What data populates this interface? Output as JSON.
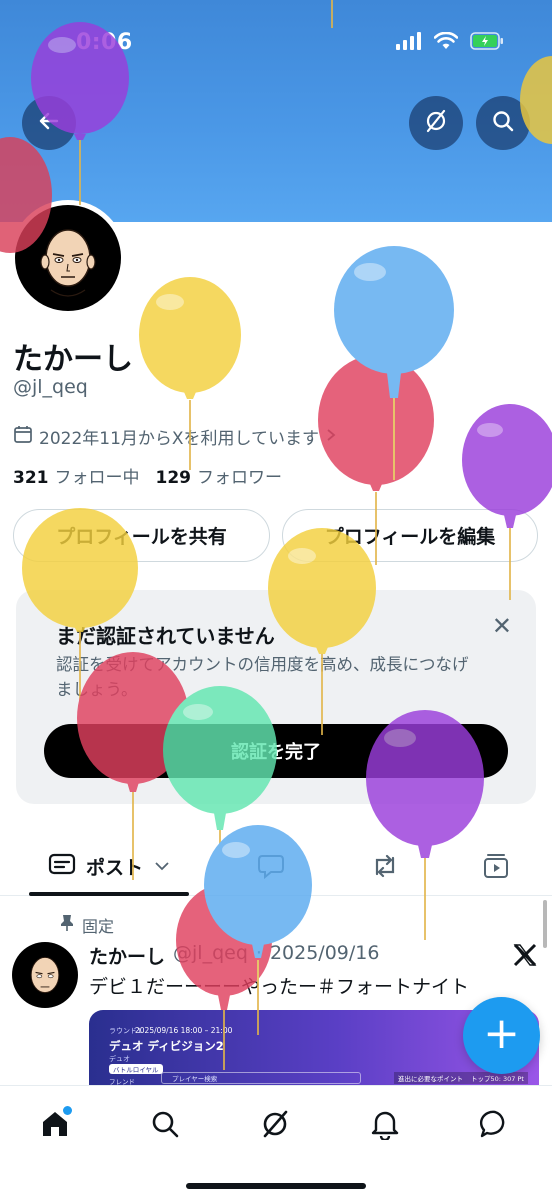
{
  "status_bar": {
    "time": "0:06"
  },
  "header": {
    "back_icon": "arrow-left-icon",
    "grok_icon": "grok-icon",
    "search_icon": "search-icon"
  },
  "profile": {
    "name": "たかーし",
    "handle": "@jl_qeq",
    "joined": "2022年11月からXを利用しています",
    "following_count": "321",
    "following_label": "フォロー中",
    "followers_count": "129",
    "followers_label": "フォロワー"
  },
  "buttons": {
    "share_profile": "プロフィールを共有",
    "edit_profile": "プロフィールを編集"
  },
  "verify_card": {
    "title": "まだ認証されていません",
    "description": "認証を受けてアカウントの信用度を高め、成長につなげましょう。",
    "button": "認証を完了"
  },
  "tabs": {
    "posts": "ポスト"
  },
  "pinned_label": "固定",
  "post": {
    "name": "たかーし",
    "handle": "@jl_qeq",
    "date": "2025/09/16",
    "text": "デビ１だーーーーやったー＃フォートナイト",
    "media": {
      "round": "ラウンド1",
      "time": "2025/09/16 18:00 – 21:00",
      "title": "デュオ ディビジョン2",
      "sub": "デュオ",
      "tag": "バトルロイヤル",
      "friend": "フレンド",
      "search_placeholder": "プレイヤー検索",
      "required_points": "進出に必要なポイント",
      "top_points": "トップ50: 307 Pt"
    }
  },
  "colors": {
    "accent": "#1d9bf0",
    "banner": "#4a97e6"
  }
}
